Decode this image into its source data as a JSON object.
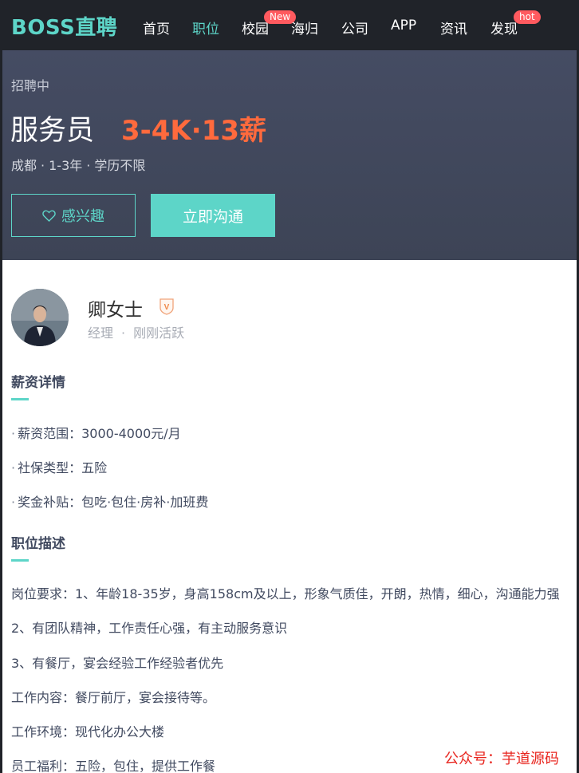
{
  "nav": {
    "logo": "BOSS直聘",
    "items": [
      {
        "label": "首页",
        "active": false
      },
      {
        "label": "职位",
        "active": true
      },
      {
        "label": "校园",
        "active": false,
        "badge": "New"
      },
      {
        "label": "海归",
        "active": false
      },
      {
        "label": "公司",
        "active": false
      },
      {
        "label": "APP",
        "active": false
      },
      {
        "label": "资讯",
        "active": false
      },
      {
        "label": "发现",
        "active": false,
        "badge": "hot"
      }
    ]
  },
  "job": {
    "status": "招聘中",
    "title": "服务员",
    "salary": "3-4K·13薪",
    "city": "成都",
    "experience": "1-3年",
    "education": "学历不限",
    "interest_label": "感兴趣",
    "chat_label": "立即沟通"
  },
  "recruiter": {
    "name": "卿女士",
    "role": "经理",
    "activity": "刚刚活跃",
    "verify_letter": "V"
  },
  "salary_section": {
    "title": "薪资详情",
    "items": [
      {
        "bullet": "·",
        "text": "薪资范围：3000-4000元/月"
      },
      {
        "bullet": "·",
        "text": "社保类型：五险"
      },
      {
        "bullet": "·",
        "text": "奖金补贴：包吃·包住·房补·加班费"
      }
    ]
  },
  "description_section": {
    "title": "职位描述",
    "lines": [
      "岗位要求：1、年龄18-35岁，身高158cm及以上，形象气质佳，开朗，热情，细心，沟通能力强",
      "2、有团队精神，工作责任心强，有主动服务意识",
      "3、有餐厅，宴会经验工作经验者优先",
      "工作内容：餐厅前厅，宴会接待等。",
      "工作环境：现代化办公大楼",
      "员工福利：五险，包住，提供工作餐"
    ]
  },
  "watermark": "公众号：芋道源码",
  "colors": {
    "nav_bg": "#202329",
    "accent": "#5dd5c8",
    "salary": "#ff6a3d",
    "header_bg": "#454c63",
    "badge": "#ff5a5f",
    "watermark": "#e8261f"
  }
}
